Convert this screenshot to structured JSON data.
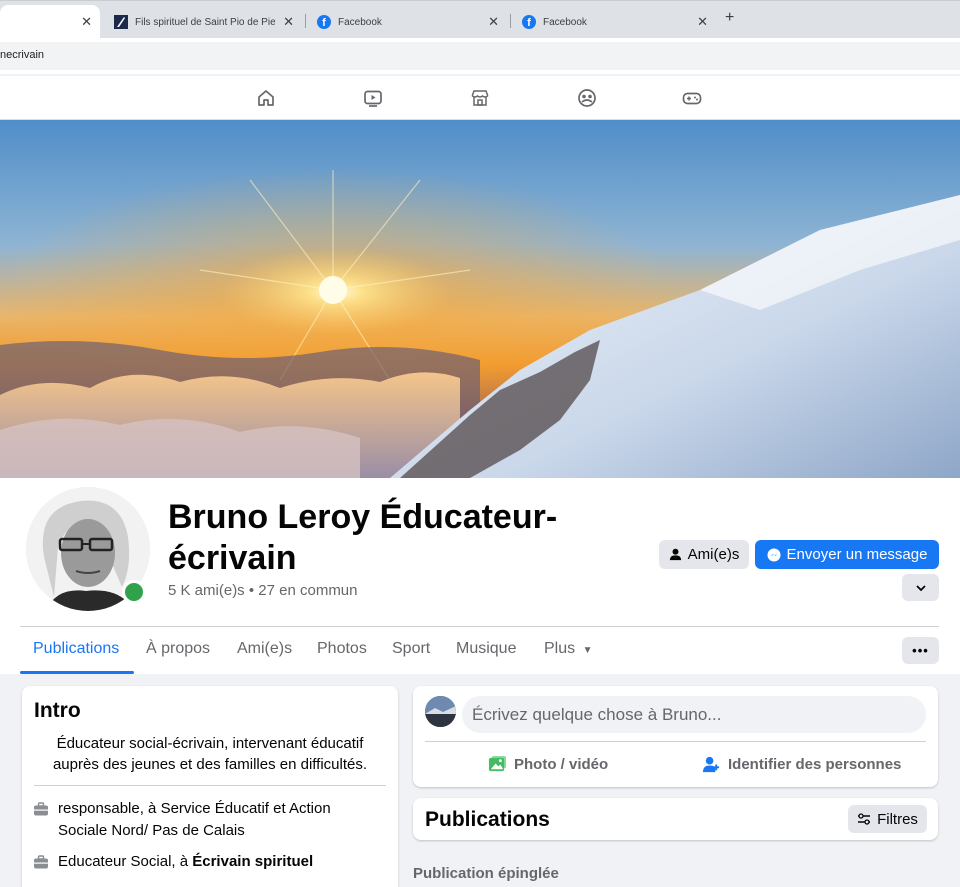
{
  "browser": {
    "tabs": [
      {
        "title": ""
      },
      {
        "title": "Fils spirituel de Saint Pio de Pie"
      },
      {
        "title": "Facebook"
      },
      {
        "title": "Facebook"
      }
    ],
    "url": "necrivain"
  },
  "profile": {
    "name": "Bruno Leroy Éducateur-écrivain",
    "friends_line": "5 K ami(e)s • 27 en commun",
    "friends_button": "Ami(e)s",
    "message_button": "Envoyer un message"
  },
  "profile_tabs": [
    "Publications",
    "À propos",
    "Ami(e)s",
    "Photos",
    "Sport",
    "Musique",
    "Plus"
  ],
  "intro": {
    "title": "Intro",
    "bio": "Éducateur social-écrivain, intervenant éducatif auprès des jeunes et des familles en difficultés.",
    "work": [
      {
        "prefix": "responsable, à ",
        "place": "Service Éducatif et Action Sociale Nord/ Pas de Calais"
      },
      {
        "prefix": "Educateur Social, à ",
        "place": "Écrivain spirituel"
      }
    ]
  },
  "composer": {
    "placeholder": "Écrivez quelque chose à Bruno...",
    "photo_label": "Photo / vidéo",
    "tag_label": "Identifier des personnes"
  },
  "feed": {
    "title": "Publications",
    "filters_label": "Filtres",
    "pinned_label": "Publication épinglée"
  },
  "colors": {
    "accent": "#1877f2",
    "online": "#31a24c"
  }
}
